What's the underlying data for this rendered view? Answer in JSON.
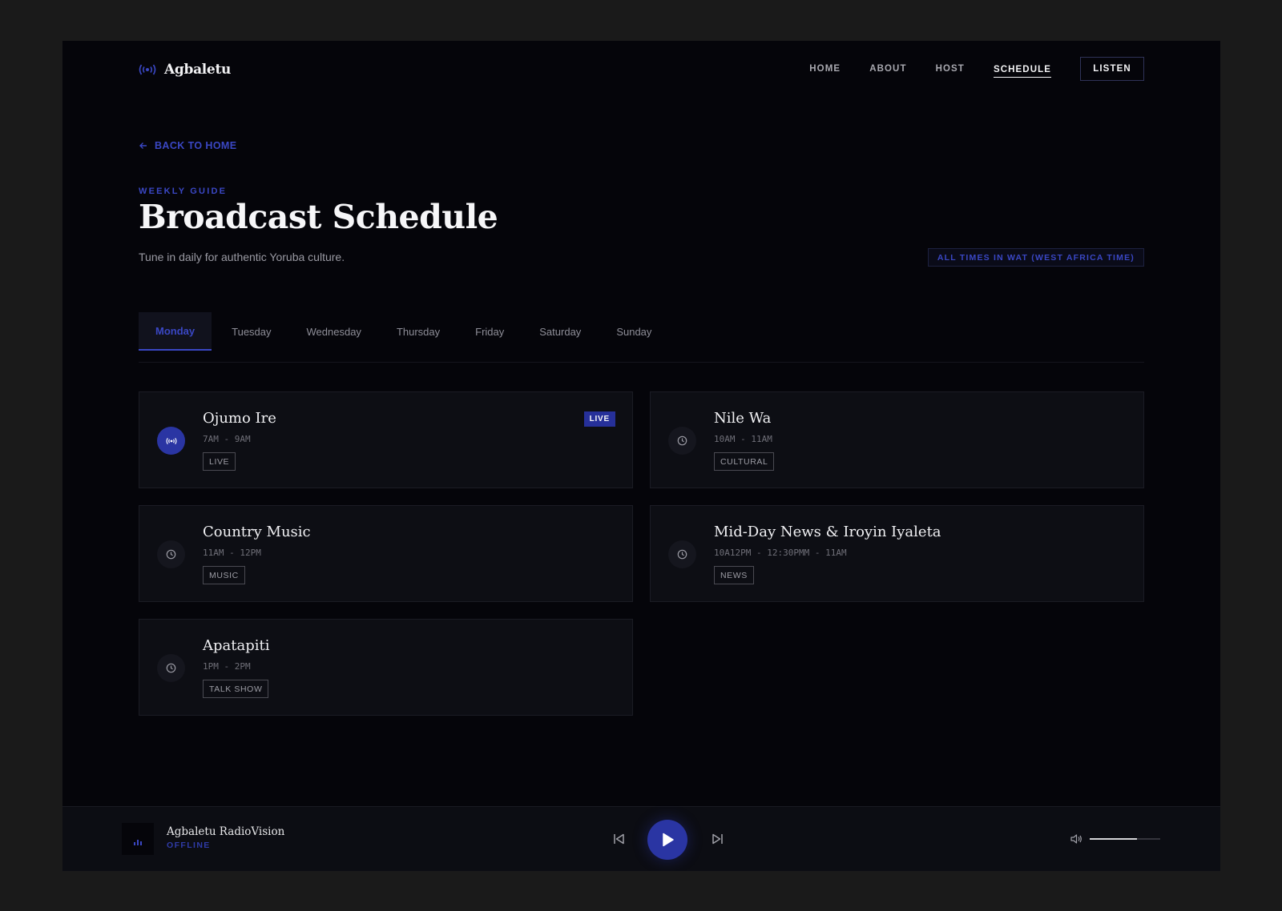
{
  "brand": {
    "name": "Agbaletu",
    "icon": "broadcast-icon"
  },
  "nav": {
    "links": [
      {
        "label": "HOME",
        "active": false
      },
      {
        "label": "ABOUT",
        "active": false
      },
      {
        "label": "HOST",
        "active": false
      },
      {
        "label": "SCHEDULE",
        "active": true
      }
    ],
    "listen_label": "LISTEN"
  },
  "back_label": "BACK TO HOME",
  "eyebrow": "WEEKLY GUIDE",
  "title": "Broadcast Schedule",
  "subtitle": "Tune in daily for authentic Yoruba culture.",
  "timezone_badge": "ALL TIMES IN WAT (WEST AFRICA TIME)",
  "tabs": [
    "Monday",
    "Tuesday",
    "Wednesday",
    "Thursday",
    "Friday",
    "Saturday",
    "Sunday"
  ],
  "active_tab": "Monday",
  "programs": [
    {
      "name": "Ojumo Ire",
      "time": "7AM - 9AM",
      "tag": "LIVE",
      "live": true,
      "live_badge": "LIVE",
      "icon": "broadcast-icon"
    },
    {
      "name": "Nile Wa",
      "time": "10AM - 11AM",
      "tag": "CULTURAL",
      "live": false,
      "icon": "clock-icon"
    },
    {
      "name": "Country Music",
      "time": "11AM - 12PM",
      "tag": "MUSIC",
      "live": false,
      "icon": "clock-icon"
    },
    {
      "name": "Mid-Day News & Iroyin Iyaleta",
      "time": "10A12PM - 12:30PMM - 11AM",
      "tag": "NEWS",
      "live": false,
      "icon": "clock-icon"
    },
    {
      "name": "Apatapiti",
      "time": "1PM - 2PM",
      "tag": "TALK SHOW",
      "live": false,
      "icon": "clock-icon"
    }
  ],
  "player": {
    "station": "Agbaletu RadioVision",
    "status": "OFFLINE",
    "volume": 0.67,
    "colors": {
      "accent": "#2a35a3"
    }
  }
}
